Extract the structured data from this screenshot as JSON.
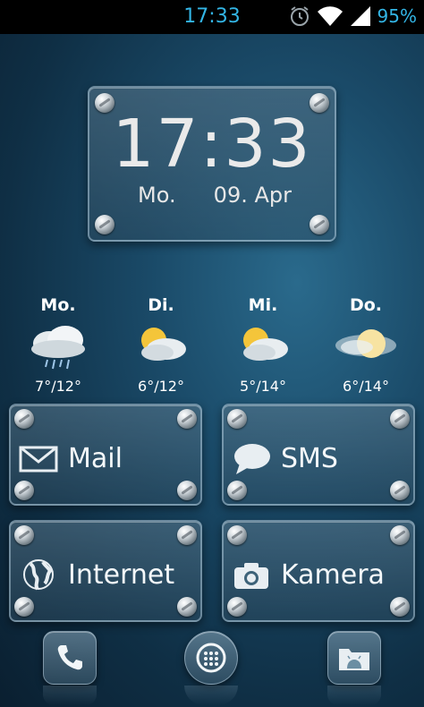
{
  "status_bar": {
    "time": "17:33",
    "battery": "95%",
    "icons": [
      "alarm-icon",
      "wifi-icon",
      "signal-icon"
    ],
    "accent_color": "#33b5e5"
  },
  "clock_widget": {
    "time": "17:33",
    "day": "Mo.",
    "date": "09. Apr"
  },
  "weather": [
    {
      "day": "Mo.",
      "icon": "rain-cloud-icon",
      "temp": "7°/12°"
    },
    {
      "day": "Di.",
      "icon": "partly-cloudy-icon",
      "temp": "6°/12°"
    },
    {
      "day": "Mi.",
      "icon": "partly-cloudy-icon",
      "temp": "5°/14°"
    },
    {
      "day": "Do.",
      "icon": "hazy-sun-icon",
      "temp": "6°/14°"
    }
  ],
  "shortcuts": [
    {
      "label": "Mail",
      "icon": "mail-icon"
    },
    {
      "label": "SMS",
      "icon": "speech-bubble-icon"
    },
    {
      "label": "Internet",
      "icon": "globe-icon"
    },
    {
      "label": "Kamera",
      "icon": "camera-icon"
    }
  ],
  "dock": [
    {
      "icon": "phone-icon"
    },
    {
      "icon": "app-drawer-icon"
    },
    {
      "icon": "folder-android-icon"
    }
  ]
}
